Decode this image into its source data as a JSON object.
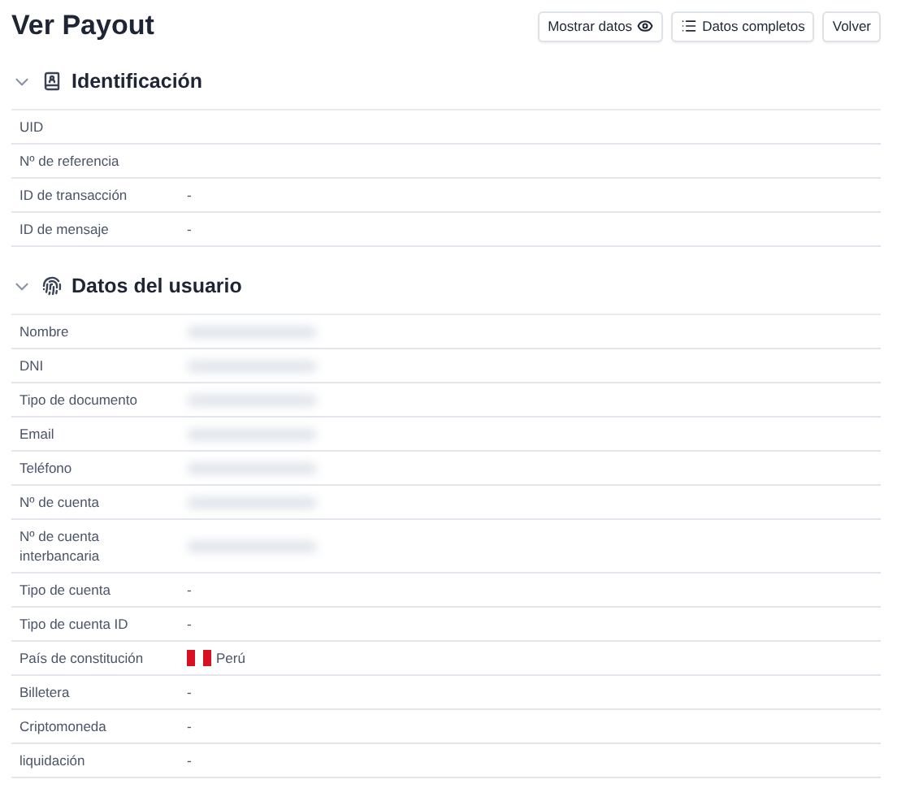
{
  "title": "Ver Payout",
  "buttons": [
    {
      "label": "Mostrar datos"
    },
    {
      "label": "Datos completos"
    },
    {
      "label": "Volver"
    }
  ],
  "sections": [
    {
      "title": "Identificación",
      "expanded": true,
      "rows": [
        {
          "label": "UID",
          "kind": "empty"
        },
        {
          "label": "Nº de referencia",
          "kind": "empty"
        },
        {
          "label": "ID de transacción",
          "kind": "text",
          "value": "-"
        },
        {
          "label": "ID de mensaje",
          "kind": "text",
          "value": "-"
        }
      ]
    },
    {
      "title": "Datos del usuario",
      "expanded": true,
      "rows": [
        {
          "label": "Nombre",
          "kind": "redacted"
        },
        {
          "label": "DNI",
          "kind": "redacted"
        },
        {
          "label": "Tipo de documento",
          "kind": "redacted"
        },
        {
          "label": "Email",
          "kind": "redacted"
        },
        {
          "label": "Teléfono",
          "kind": "redacted"
        },
        {
          "label": "Nº de cuenta",
          "kind": "redacted"
        },
        {
          "label": "Nº de cuenta interbancaria",
          "kind": "redacted"
        },
        {
          "label": "Tipo de cuenta",
          "kind": "text",
          "value": "-"
        },
        {
          "label": "Tipo de cuenta ID",
          "kind": "text",
          "value": "-"
        },
        {
          "label": "País de constitución",
          "kind": "flag",
          "value": "Perú"
        },
        {
          "label": "Billetera",
          "kind": "text",
          "value": "-"
        },
        {
          "label": "Criptomoneda",
          "kind": "text",
          "value": "-"
        },
        {
          "label": "liquidación",
          "kind": "text",
          "value": "-"
        }
      ]
    }
  ]
}
